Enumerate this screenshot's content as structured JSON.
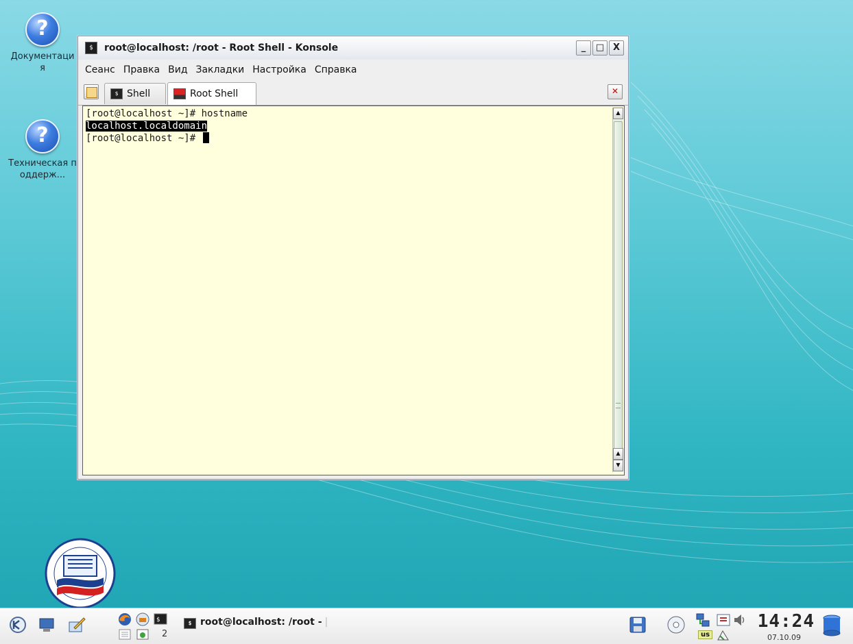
{
  "desktop": {
    "icons": [
      {
        "label": "Документация",
        "icon": "help-icon"
      },
      {
        "label": "Техническая поддерж...",
        "icon": "help-icon"
      }
    ]
  },
  "window": {
    "title": "root@localhost: /root - Root Shell - Konsole",
    "controls": {
      "minimize": "_",
      "maximize": "□",
      "close": "X"
    },
    "menu": [
      "Сеанс",
      "Правка",
      "Вид",
      "Закладки",
      "Настройка",
      "Справка"
    ],
    "tabs": [
      {
        "label": "Shell",
        "icon": "terminal-icon",
        "active": false
      },
      {
        "label": "Root Shell",
        "icon": "root-terminal-icon",
        "active": true
      }
    ],
    "terminal": {
      "lines": [
        "[root@localhost ~]# hostname",
        "localhost.localdomain",
        "[root@localhost ~]# "
      ],
      "selected_line_index": 1,
      "background": "#ffffdd"
    }
  },
  "taskbar": {
    "task_label": "root@localhost: /root - ",
    "pager_desktop": "2",
    "keyboard_layout": "us",
    "clock": "14:24",
    "date": "07.10.09"
  }
}
